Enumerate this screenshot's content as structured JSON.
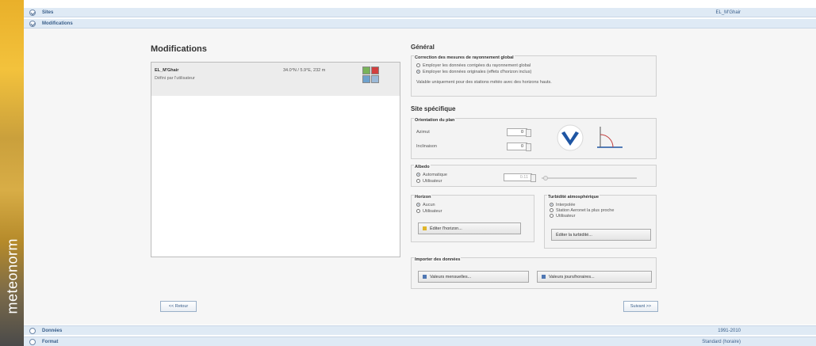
{
  "brand": {
    "name": "meteonorm"
  },
  "sections": {
    "sites": {
      "label": "Sites",
      "value": "EL_M'Ghair"
    },
    "modifications": {
      "label": "Modifications"
    },
    "donnees": {
      "label": "Données",
      "value": "1991-2010"
    },
    "resultats": {
      "label": "Format",
      "value": "Standard (horaire)"
    }
  },
  "modifications": {
    "title": "Modifications",
    "item": {
      "name": "EL_M'Ghair",
      "subtitle": "Défini par l'utilisateur",
      "coords": "34.0°N / 5.9°E, 232 m"
    }
  },
  "general": {
    "title": "Général",
    "correction": {
      "title": "Correction des mesures de rayonnement global",
      "option1": "Employer les données corrigées du rayonnement global",
      "option2": "Employer les données originales (effets d'horizon inclus)",
      "note": "Valable uniquement pour des stations météo avec des horizons hauts."
    }
  },
  "site": {
    "title": "Site spécifique",
    "orientation": {
      "title": "Orientation du plan",
      "azimut_label": "Azimut",
      "azimut_value": "0",
      "inclinaison_label": "Inclinaison",
      "inclinaison_value": "0"
    },
    "albedo": {
      "title": "Albedo",
      "auto": "Automatique",
      "user": "Utilisateur",
      "value": "0.11"
    },
    "horizon": {
      "title": "Horizon",
      "opt1": "Aucun",
      "opt2": "Utilisateur",
      "button": "Éditer l'horizon..."
    },
    "turbidite": {
      "title": "Turbidité atmosphérique",
      "opt1": "Interpolée",
      "opt2": "Station Aeronet la plus proche",
      "opt3": "Utilisateur",
      "button": "Éditer la turbidité..."
    },
    "import": {
      "title": "Importer des données",
      "btn1": "Valeurs mensuelles...",
      "btn2": "Valeurs jours/horaires..."
    }
  },
  "footer": {
    "back": "<< Retour",
    "next": "Suivant >>"
  },
  "colors": {
    "accent": "#3a5f8a",
    "header_bg": "#dfeaf5",
    "brand": "#e9b02a"
  }
}
